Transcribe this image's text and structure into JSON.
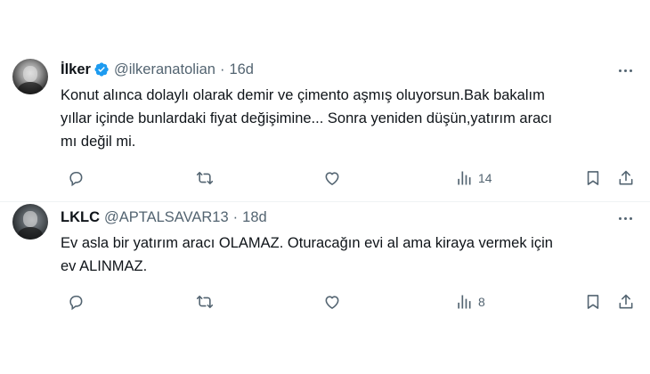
{
  "tweets": [
    {
      "name": "İlker",
      "verified": true,
      "handle": "@ilkeranatolian",
      "separator": "·",
      "time": "16d",
      "text": "Konut alınca dolaylı olarak demir ve çimento aşmış oluyorsun.Bak bakalım\nyıllar içinde bunlardaki fiyat değişimine... Sonra yeniden düşün,yatırım aracı\nmı değil mi.",
      "views": "14",
      "icons": [
        "reply-icon",
        "retweet-icon",
        "like-icon",
        "views-icon",
        "bookmark-icon",
        "share-icon"
      ]
    },
    {
      "name": "LKLC",
      "verified": false,
      "handle": "@APTALSAVAR13",
      "separator": "·",
      "time": "18d",
      "text": "Ev asla bir yatırım aracı OLAMAZ. Oturacağın evi al ama kiraya vermek için\nev ALINMAZ.",
      "views": "8",
      "icons": [
        "reply-icon",
        "retweet-icon",
        "like-icon",
        "views-icon",
        "bookmark-icon",
        "share-icon"
      ]
    }
  ],
  "colors": {
    "text": "#0f1419",
    "secondary": "#536471",
    "verified": "#1d9bf0",
    "divider": "#eff3f4"
  }
}
